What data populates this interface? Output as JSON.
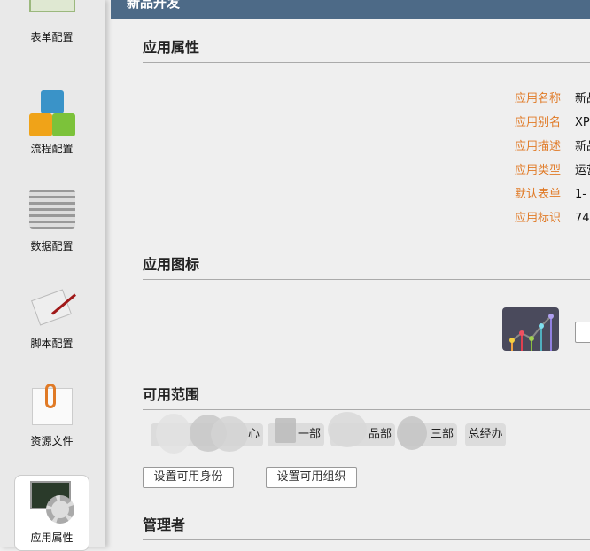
{
  "header": {
    "title": "新品开发"
  },
  "sidebar": {
    "items": [
      {
        "label": "表单配置",
        "icon": "form-icon"
      },
      {
        "label": "流程配置",
        "icon": "flow-icon"
      },
      {
        "label": "数据配置",
        "icon": "data-icon"
      },
      {
        "label": "脚本配置",
        "icon": "script-icon"
      },
      {
        "label": "资源文件",
        "icon": "paperclip-icon"
      },
      {
        "label": "应用属性",
        "icon": "gear-icon",
        "active": true
      }
    ]
  },
  "sections": {
    "props": "应用属性",
    "icon": "应用图标",
    "scope": "可用范围",
    "admins": "管理者"
  },
  "properties": [
    {
      "key": "应用名称",
      "value": "新品"
    },
    {
      "key": "应用别名",
      "value": "XP"
    },
    {
      "key": "应用描述",
      "value": "新品"
    },
    {
      "key": "应用类型",
      "value": "运营"
    },
    {
      "key": "默认表单",
      "value": "1-"
    },
    {
      "key": "应用标识",
      "value": "74"
    }
  ],
  "scope": {
    "chips": [
      "心",
      "一部",
      "品部",
      "三部",
      "总经办"
    ],
    "set_identity": "设置可用身份",
    "set_org": "设置可用组织"
  },
  "colors": {
    "header": "#4d6a87",
    "key": "#e07a26"
  }
}
